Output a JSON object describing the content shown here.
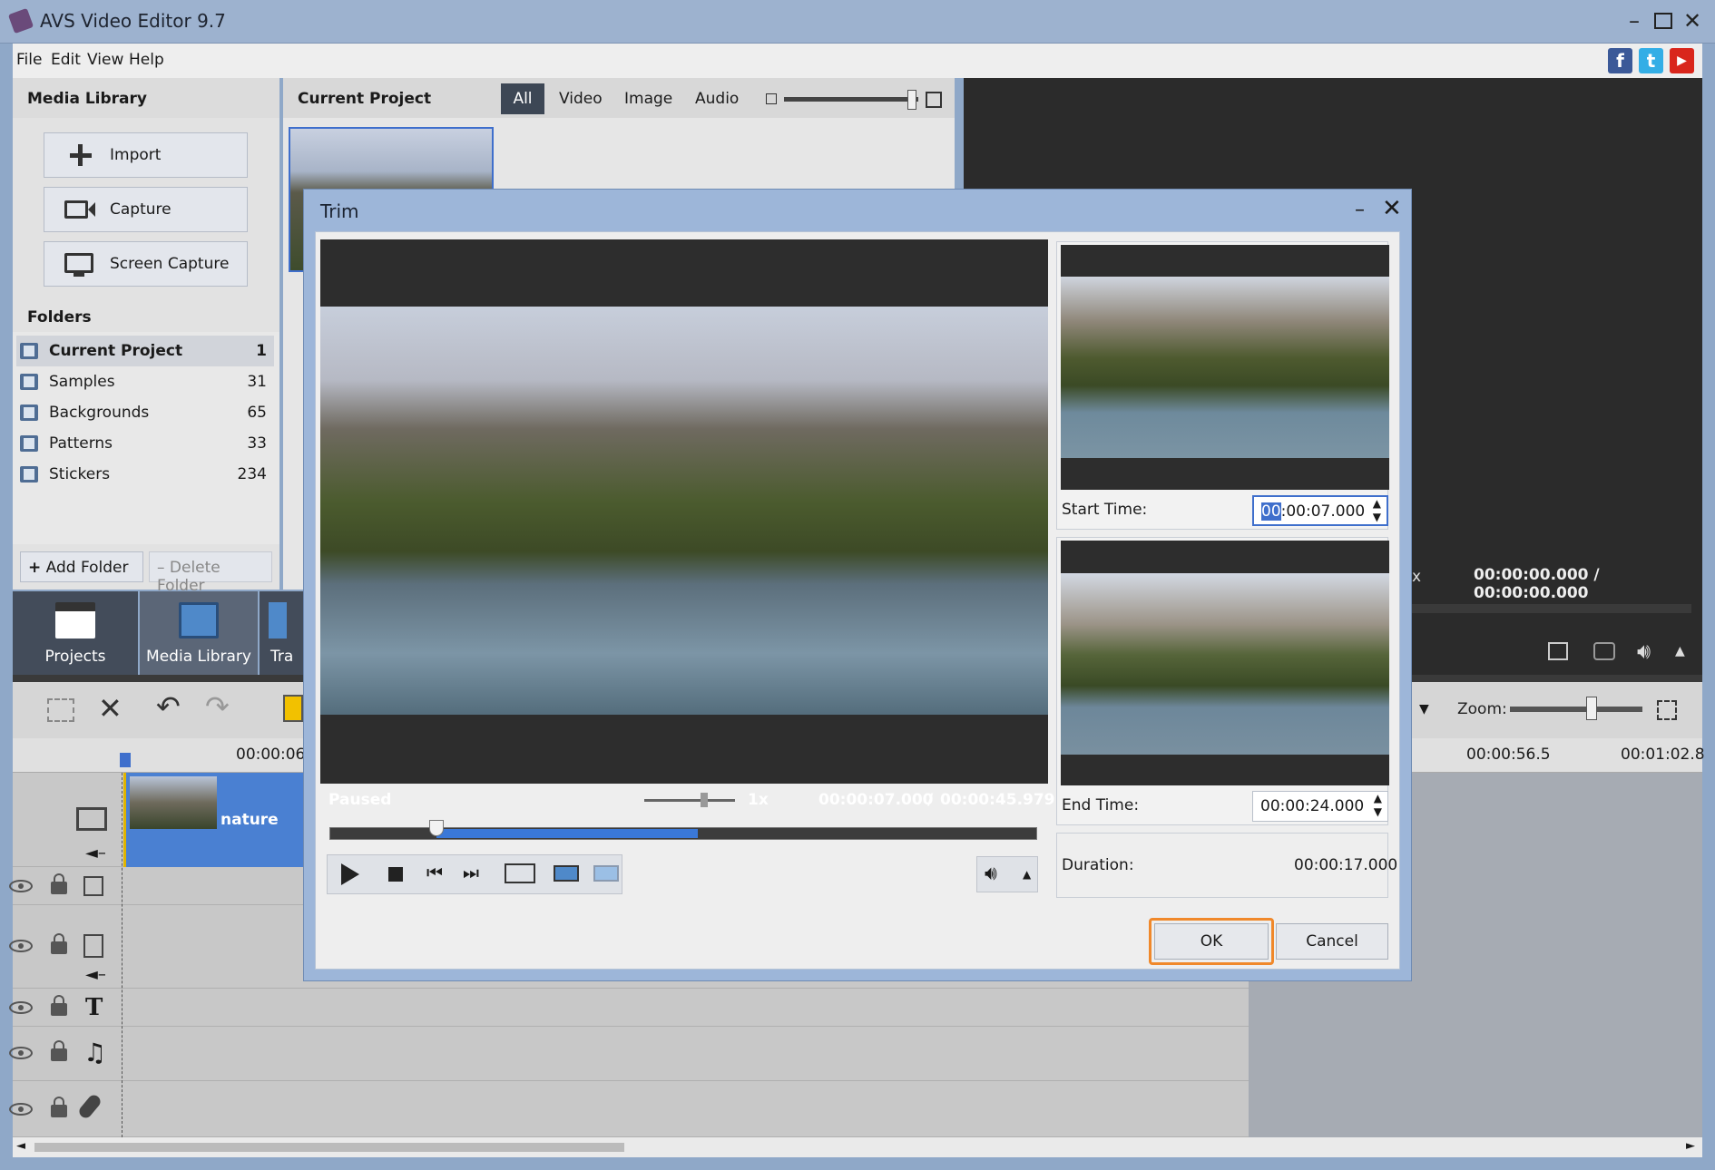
{
  "app": {
    "title": "AVS Video Editor 9.7"
  },
  "menu": [
    "File",
    "Edit",
    "View",
    "Help"
  ],
  "social": [
    {
      "name": "facebook-icon",
      "glyph": "f",
      "color": "#3b5998"
    },
    {
      "name": "twitter-icon",
      "glyph": "t",
      "color": "#33aee6"
    },
    {
      "name": "youtube-icon",
      "glyph": "▶",
      "color": "#d9261c"
    }
  ],
  "media_library": {
    "title": "Media Library",
    "buttons": [
      "Import",
      "Capture",
      "Screen Capture"
    ],
    "folders_title": "Folders",
    "folders": [
      {
        "name": "Current Project",
        "count": "1"
      },
      {
        "name": "Samples",
        "count": "31"
      },
      {
        "name": "Backgrounds",
        "count": "65"
      },
      {
        "name": "Patterns",
        "count": "33"
      },
      {
        "name": "Stickers",
        "count": "234"
      }
    ],
    "add_folder": "Add Folder",
    "delete_folder": "Delete Folder"
  },
  "current_project": {
    "title": "Current Project",
    "filters": [
      "All",
      "Video",
      "Image",
      "Audio"
    ],
    "active_filter": "All"
  },
  "nav_tabs": [
    "Projects",
    "Media Library",
    "Tra"
  ],
  "preview": {
    "time": "00:00:00.000 / 00:00:00.000",
    "x_glyph": "x"
  },
  "timeline": {
    "ruler": [
      "00:00:06.",
      "00:00:56.5",
      "00:01:02.8"
    ],
    "clip_label": "nature",
    "zoom_label": "Zoom:",
    "zoom_level": 0.6
  },
  "trim": {
    "title": "Trim",
    "status": "Paused",
    "speed": "1x",
    "position": "00:00:07.000",
    "total": "00:00:45.979",
    "time_sep": "/",
    "progress_start": 0.15,
    "progress_end": 0.52,
    "start_label": "Start Time:",
    "start_time_selected": "00",
    "start_time_rest": ":00:07.000",
    "end_label": "End Time:",
    "end_time": "00:00:24.000",
    "duration_label": "Duration:",
    "duration": "00:00:17.000",
    "ok": "OK",
    "cancel": "Cancel",
    "accent": "#f0882a"
  }
}
